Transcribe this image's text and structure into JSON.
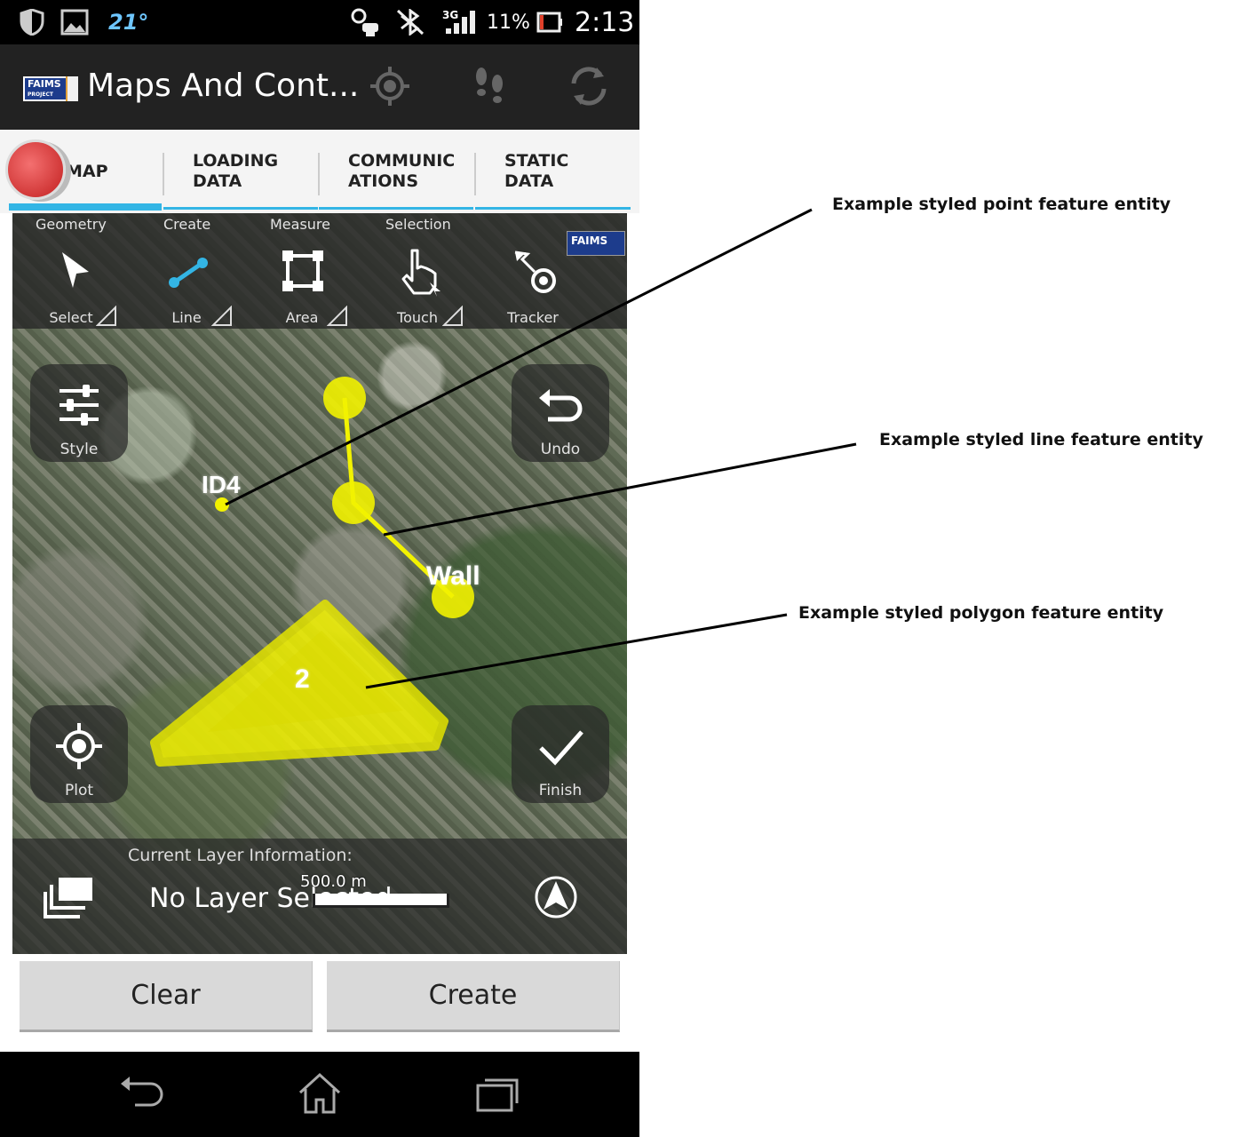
{
  "status_bar": {
    "temperature": "21°",
    "network": "3G",
    "battery_percent": "11%",
    "time": "2:13"
  },
  "action_bar": {
    "logo_text": "FAIMS",
    "logo_subtext": "PROJECT",
    "title": "Maps And Cont...",
    "icons": [
      "gps-target-icon",
      "footsteps-icon",
      "sync-icon"
    ]
  },
  "tabs": [
    {
      "label": "MAP",
      "selected": true
    },
    {
      "label": "LOADING DATA",
      "line1": "LOADING",
      "line2": "DATA"
    },
    {
      "label": "COMMUNICATIONS",
      "line1": "COMMUNIC",
      "line2": "ATIONS"
    },
    {
      "label": "STATIC DATA",
      "line1": "STATIC",
      "line2": "DATA"
    }
  ],
  "map_toolbar": {
    "categories": [
      "Geometry",
      "Create",
      "Measure",
      "Selection"
    ],
    "tools": [
      {
        "label": "Select",
        "icon": "arrow-cursor-icon"
      },
      {
        "label": "Line",
        "icon": "line-segment-icon"
      },
      {
        "label": "Area",
        "icon": "area-square-icon"
      },
      {
        "label": "Touch",
        "icon": "hand-pointer-icon"
      },
      {
        "label": "Tracker",
        "icon": "tracker-icon"
      }
    ],
    "logo_text": "FAIMS"
  },
  "map_buttons": {
    "style": "Style",
    "undo": "Undo",
    "plot": "Plot",
    "finish": "Finish"
  },
  "features": {
    "point_label": "ID4",
    "line_label": "Wall",
    "polygon_label": "2",
    "feature_color": "#f2f200"
  },
  "layer_info": {
    "heading": "Current Layer Information:",
    "value": "No Layer Selected",
    "scale": "500.0 m"
  },
  "buttons": {
    "clear": "Clear",
    "create": "Create"
  },
  "annotations": {
    "point": "Example styled point feature entity",
    "line": "Example styled line feature entity",
    "polygon": "Example styled polygon feature entity"
  },
  "colors": {
    "accent": "#33b5e5",
    "action_bar": "#222222",
    "status_bar": "#000000"
  }
}
